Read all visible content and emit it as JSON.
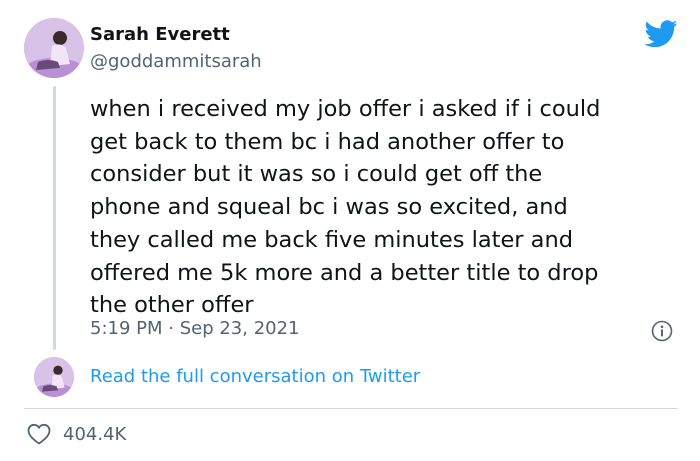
{
  "author": {
    "display_name": "Sarah Everett",
    "handle": "@goddammitsarah",
    "avatar_icon": "user-avatar"
  },
  "tweet": {
    "text": "when i received my job offer i asked if i could\nget back to them bc i had another offer to\nconsider but it was so i could get off the\nphone and squeal bc i was so excited, and\nthey called me back five minutes later and\noffered me 5k more and a better title to drop\nthe other offer",
    "timestamp": "5:19 PM · Sep 23, 2021"
  },
  "footer": {
    "read_more_label": "Read the full conversation on Twitter",
    "like_count": "404.4K"
  },
  "colors": {
    "text_primary": "#0f1419",
    "text_secondary": "#536471",
    "link": "#1d9bf0",
    "twitter_blue": "#1d9bf0",
    "divider": "#cfd9de"
  },
  "icons": [
    "twitter-bird-icon",
    "info-icon",
    "heart-icon"
  ]
}
